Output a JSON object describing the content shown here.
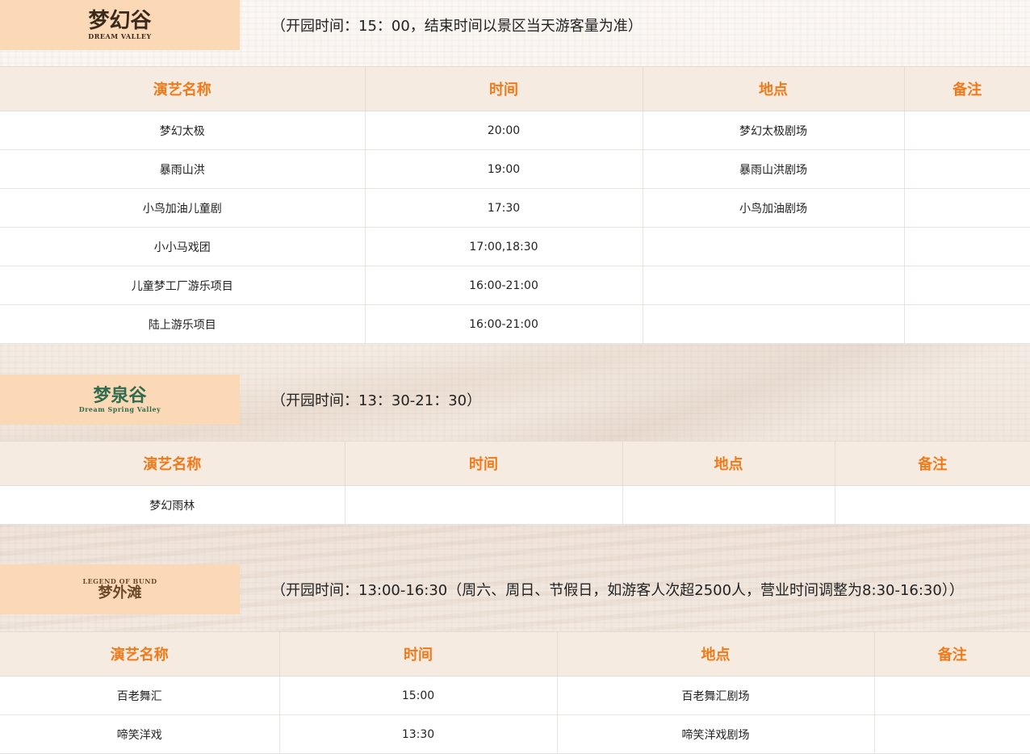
{
  "sections": [
    {
      "logo": {
        "text": "梦幻谷",
        "sub": "DREAM VALLEY"
      },
      "hours": "（开园时间：15：00，结束时间以景区当天游客量为准）",
      "headers": [
        "演艺名称",
        "时间",
        "地点",
        "备注"
      ],
      "rows": [
        [
          "梦幻太极",
          "20:00",
          "梦幻太极剧场",
          ""
        ],
        [
          "暴雨山洪",
          "19:00",
          "暴雨山洪剧场",
          ""
        ],
        [
          "小鸟加油儿童剧",
          "17:30",
          "小鸟加油剧场",
          ""
        ],
        [
          "小小马戏团",
          "17:00,18:30",
          "",
          ""
        ],
        [
          "儿童梦工厂游乐项目",
          "16:00-21:00",
          "",
          ""
        ],
        [
          "陆上游乐项目",
          "16:00-21:00",
          "",
          ""
        ]
      ]
    },
    {
      "logo": {
        "text": "梦泉谷",
        "sub": "Dream Spring Valley"
      },
      "hours": "（开园时间：13：30-21：30）",
      "headers": [
        "演艺名称",
        "时间",
        "地点",
        "备注"
      ],
      "rows": [
        [
          "梦幻雨林",
          "",
          "",
          ""
        ]
      ]
    },
    {
      "logo": {
        "text": "梦外滩",
        "sub": "LEGEND OF BUND"
      },
      "hours": "（开园时间：13:00-16:30（周六、周日、节假日，如游客人次超2500人，营业时间调整为8:30-16:30））",
      "headers": [
        "演艺名称",
        "时间",
        "地点",
        "备注"
      ],
      "rows": [
        [
          "百老舞汇",
          "15:00",
          "百老舞汇剧场",
          ""
        ],
        [
          "啼笑洋戏",
          "13:30",
          "啼笑洋戏剧场",
          ""
        ]
      ]
    }
  ]
}
